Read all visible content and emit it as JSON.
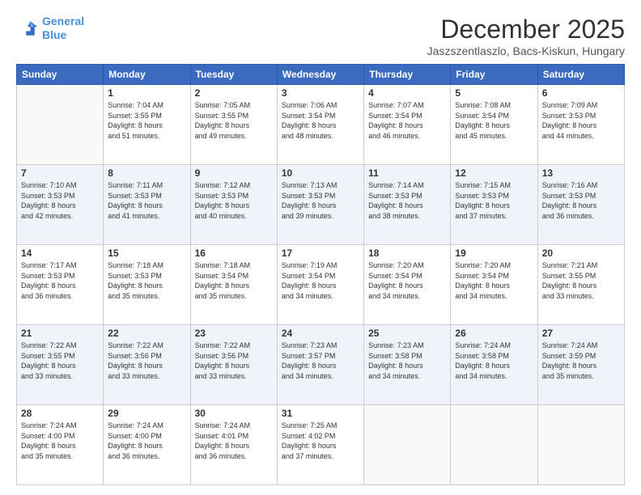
{
  "logo": {
    "line1": "General",
    "line2": "Blue"
  },
  "title": "December 2025",
  "subtitle": "Jaszszentlaszlo, Bacs-Kiskun, Hungary",
  "days_header": [
    "Sunday",
    "Monday",
    "Tuesday",
    "Wednesday",
    "Thursday",
    "Friday",
    "Saturday"
  ],
  "weeks": [
    [
      {
        "day": "",
        "info": ""
      },
      {
        "day": "1",
        "info": "Sunrise: 7:04 AM\nSunset: 3:55 PM\nDaylight: 8 hours\nand 51 minutes."
      },
      {
        "day": "2",
        "info": "Sunrise: 7:05 AM\nSunset: 3:55 PM\nDaylight: 8 hours\nand 49 minutes."
      },
      {
        "day": "3",
        "info": "Sunrise: 7:06 AM\nSunset: 3:54 PM\nDaylight: 8 hours\nand 48 minutes."
      },
      {
        "day": "4",
        "info": "Sunrise: 7:07 AM\nSunset: 3:54 PM\nDaylight: 8 hours\nand 46 minutes."
      },
      {
        "day": "5",
        "info": "Sunrise: 7:08 AM\nSunset: 3:54 PM\nDaylight: 8 hours\nand 45 minutes."
      },
      {
        "day": "6",
        "info": "Sunrise: 7:09 AM\nSunset: 3:53 PM\nDaylight: 8 hours\nand 44 minutes."
      }
    ],
    [
      {
        "day": "7",
        "info": "Sunrise: 7:10 AM\nSunset: 3:53 PM\nDaylight: 8 hours\nand 42 minutes."
      },
      {
        "day": "8",
        "info": "Sunrise: 7:11 AM\nSunset: 3:53 PM\nDaylight: 8 hours\nand 41 minutes."
      },
      {
        "day": "9",
        "info": "Sunrise: 7:12 AM\nSunset: 3:53 PM\nDaylight: 8 hours\nand 40 minutes."
      },
      {
        "day": "10",
        "info": "Sunrise: 7:13 AM\nSunset: 3:53 PM\nDaylight: 8 hours\nand 39 minutes."
      },
      {
        "day": "11",
        "info": "Sunrise: 7:14 AM\nSunset: 3:53 PM\nDaylight: 8 hours\nand 38 minutes."
      },
      {
        "day": "12",
        "info": "Sunrise: 7:15 AM\nSunset: 3:53 PM\nDaylight: 8 hours\nand 37 minutes."
      },
      {
        "day": "13",
        "info": "Sunrise: 7:16 AM\nSunset: 3:53 PM\nDaylight: 8 hours\nand 36 minutes."
      }
    ],
    [
      {
        "day": "14",
        "info": "Sunrise: 7:17 AM\nSunset: 3:53 PM\nDaylight: 8 hours\nand 36 minutes."
      },
      {
        "day": "15",
        "info": "Sunrise: 7:18 AM\nSunset: 3:53 PM\nDaylight: 8 hours\nand 35 minutes."
      },
      {
        "day": "16",
        "info": "Sunrise: 7:18 AM\nSunset: 3:54 PM\nDaylight: 8 hours\nand 35 minutes."
      },
      {
        "day": "17",
        "info": "Sunrise: 7:19 AM\nSunset: 3:54 PM\nDaylight: 8 hours\nand 34 minutes."
      },
      {
        "day": "18",
        "info": "Sunrise: 7:20 AM\nSunset: 3:54 PM\nDaylight: 8 hours\nand 34 minutes."
      },
      {
        "day": "19",
        "info": "Sunrise: 7:20 AM\nSunset: 3:54 PM\nDaylight: 8 hours\nand 34 minutes."
      },
      {
        "day": "20",
        "info": "Sunrise: 7:21 AM\nSunset: 3:55 PM\nDaylight: 8 hours\nand 33 minutes."
      }
    ],
    [
      {
        "day": "21",
        "info": "Sunrise: 7:22 AM\nSunset: 3:55 PM\nDaylight: 8 hours\nand 33 minutes."
      },
      {
        "day": "22",
        "info": "Sunrise: 7:22 AM\nSunset: 3:56 PM\nDaylight: 8 hours\nand 33 minutes."
      },
      {
        "day": "23",
        "info": "Sunrise: 7:22 AM\nSunset: 3:56 PM\nDaylight: 8 hours\nand 33 minutes."
      },
      {
        "day": "24",
        "info": "Sunrise: 7:23 AM\nSunset: 3:57 PM\nDaylight: 8 hours\nand 34 minutes."
      },
      {
        "day": "25",
        "info": "Sunrise: 7:23 AM\nSunset: 3:58 PM\nDaylight: 8 hours\nand 34 minutes."
      },
      {
        "day": "26",
        "info": "Sunrise: 7:24 AM\nSunset: 3:58 PM\nDaylight: 8 hours\nand 34 minutes."
      },
      {
        "day": "27",
        "info": "Sunrise: 7:24 AM\nSunset: 3:59 PM\nDaylight: 8 hours\nand 35 minutes."
      }
    ],
    [
      {
        "day": "28",
        "info": "Sunrise: 7:24 AM\nSunset: 4:00 PM\nDaylight: 8 hours\nand 35 minutes."
      },
      {
        "day": "29",
        "info": "Sunrise: 7:24 AM\nSunset: 4:00 PM\nDaylight: 8 hours\nand 36 minutes."
      },
      {
        "day": "30",
        "info": "Sunrise: 7:24 AM\nSunset: 4:01 PM\nDaylight: 8 hours\nand 36 minutes."
      },
      {
        "day": "31",
        "info": "Sunrise: 7:25 AM\nSunset: 4:02 PM\nDaylight: 8 hours\nand 37 minutes."
      },
      {
        "day": "",
        "info": ""
      },
      {
        "day": "",
        "info": ""
      },
      {
        "day": "",
        "info": ""
      }
    ]
  ]
}
